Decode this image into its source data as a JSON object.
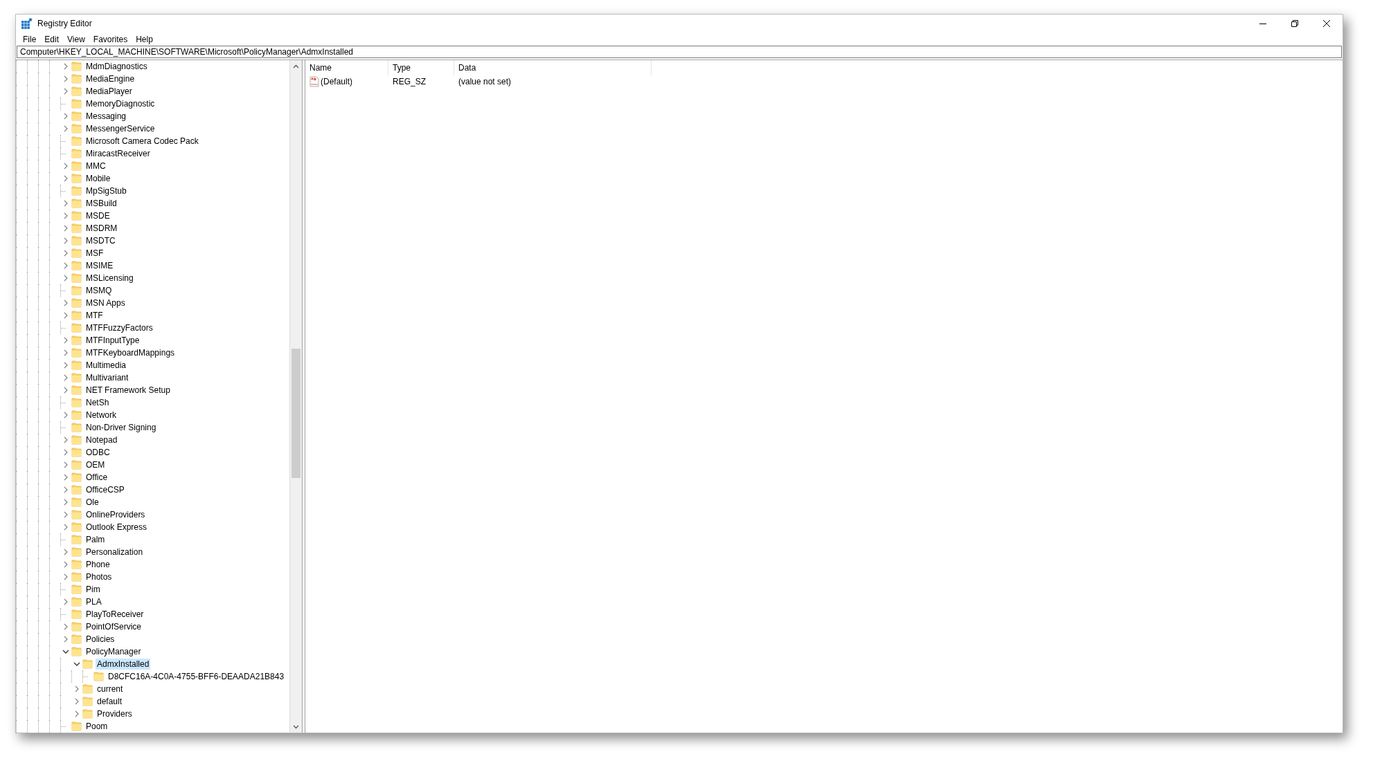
{
  "window": {
    "title": "Registry Editor"
  },
  "menu": [
    {
      "label": "File"
    },
    {
      "label": "Edit"
    },
    {
      "label": "View"
    },
    {
      "label": "Favorites"
    },
    {
      "label": "Help"
    }
  ],
  "address": {
    "value": "Computer\\HKEY_LOCAL_MACHINE\\SOFTWARE\\Microsoft\\PolicyManager\\AdmxInstalled"
  },
  "tree": {
    "items": [
      {
        "name": "MdmDiagnostics",
        "kind": "expandable",
        "expanded": false,
        "selected": false
      },
      {
        "name": "MediaEngine",
        "kind": "expandable",
        "expanded": false,
        "selected": false
      },
      {
        "name": "MediaPlayer",
        "kind": "expandable",
        "expanded": false,
        "selected": false
      },
      {
        "name": "MemoryDiagnostic",
        "kind": "leaf",
        "selected": false
      },
      {
        "name": "Messaging",
        "kind": "expandable",
        "expanded": false,
        "selected": false
      },
      {
        "name": "MessengerService",
        "kind": "expandable",
        "expanded": false,
        "selected": false
      },
      {
        "name": "Microsoft Camera Codec Pack",
        "kind": "leaf",
        "selected": false
      },
      {
        "name": "MiracastReceiver",
        "kind": "leaf",
        "selected": false
      },
      {
        "name": "MMC",
        "kind": "expandable",
        "expanded": false,
        "selected": false
      },
      {
        "name": "Mobile",
        "kind": "expandable",
        "expanded": false,
        "selected": false
      },
      {
        "name": "MpSigStub",
        "kind": "leaf",
        "selected": false
      },
      {
        "name": "MSBuild",
        "kind": "expandable",
        "expanded": false,
        "selected": false
      },
      {
        "name": "MSDE",
        "kind": "expandable",
        "expanded": false,
        "selected": false
      },
      {
        "name": "MSDRM",
        "kind": "expandable",
        "expanded": false,
        "selected": false
      },
      {
        "name": "MSDTC",
        "kind": "expandable",
        "expanded": false,
        "selected": false
      },
      {
        "name": "MSF",
        "kind": "expandable",
        "expanded": false,
        "selected": false
      },
      {
        "name": "MSIME",
        "kind": "expandable",
        "expanded": false,
        "selected": false
      },
      {
        "name": "MSLicensing",
        "kind": "expandable",
        "expanded": false,
        "selected": false
      },
      {
        "name": "MSMQ",
        "kind": "leaf",
        "selected": false
      },
      {
        "name": "MSN Apps",
        "kind": "expandable",
        "expanded": false,
        "selected": false
      },
      {
        "name": "MTF",
        "kind": "expandable",
        "expanded": false,
        "selected": false
      },
      {
        "name": "MTFFuzzyFactors",
        "kind": "leaf",
        "selected": false
      },
      {
        "name": "MTFInputType",
        "kind": "expandable",
        "expanded": false,
        "selected": false
      },
      {
        "name": "MTFKeyboardMappings",
        "kind": "expandable",
        "expanded": false,
        "selected": false
      },
      {
        "name": "Multimedia",
        "kind": "expandable",
        "expanded": false,
        "selected": false
      },
      {
        "name": "Multivariant",
        "kind": "expandable",
        "expanded": false,
        "selected": false
      },
      {
        "name": "NET Framework Setup",
        "kind": "expandable",
        "expanded": false,
        "selected": false
      },
      {
        "name": "NetSh",
        "kind": "leaf",
        "selected": false
      },
      {
        "name": "Network",
        "kind": "expandable",
        "expanded": false,
        "selected": false
      },
      {
        "name": "Non-Driver Signing",
        "kind": "leaf",
        "selected": false
      },
      {
        "name": "Notepad",
        "kind": "expandable",
        "expanded": false,
        "selected": false
      },
      {
        "name": "ODBC",
        "kind": "expandable",
        "expanded": false,
        "selected": false
      },
      {
        "name": "OEM",
        "kind": "expandable",
        "expanded": false,
        "selected": false
      },
      {
        "name": "Office",
        "kind": "expandable",
        "expanded": false,
        "selected": false
      },
      {
        "name": "OfficeCSP",
        "kind": "expandable",
        "expanded": false,
        "selected": false
      },
      {
        "name": "Ole",
        "kind": "expandable",
        "expanded": false,
        "selected": false
      },
      {
        "name": "OnlineProviders",
        "kind": "expandable",
        "expanded": false,
        "selected": false
      },
      {
        "name": "Outlook Express",
        "kind": "expandable",
        "expanded": false,
        "selected": false
      },
      {
        "name": "Palm",
        "kind": "leaf",
        "selected": false
      },
      {
        "name": "Personalization",
        "kind": "expandable",
        "expanded": false,
        "selected": false
      },
      {
        "name": "Phone",
        "kind": "expandable",
        "expanded": false,
        "selected": false
      },
      {
        "name": "Photos",
        "kind": "expandable",
        "expanded": false,
        "selected": false
      },
      {
        "name": "Pim",
        "kind": "leaf",
        "selected": false
      },
      {
        "name": "PLA",
        "kind": "expandable",
        "expanded": false,
        "selected": false
      },
      {
        "name": "PlayToReceiver",
        "kind": "leaf",
        "selected": false
      },
      {
        "name": "PointOfService",
        "kind": "expandable",
        "expanded": false,
        "selected": false
      },
      {
        "name": "Policies",
        "kind": "expandable",
        "expanded": false,
        "selected": false
      },
      {
        "name": "PolicyManager",
        "kind": "expandable",
        "expanded": true,
        "selected": false,
        "children": [
          {
            "name": "AdmxInstalled",
            "kind": "expandable",
            "expanded": true,
            "selected": true,
            "children": [
              {
                "name": "D8CFC16A-4C0A-4755-BFF6-DEAADA21B843",
                "kind": "leaf",
                "selected": false
              }
            ]
          },
          {
            "name": "current",
            "kind": "expandable",
            "expanded": false,
            "selected": false
          },
          {
            "name": "default",
            "kind": "expandable",
            "expanded": false,
            "selected": false
          },
          {
            "name": "Providers",
            "kind": "expandable",
            "expanded": false,
            "selected": false
          }
        ]
      },
      {
        "name": "Poom",
        "kind": "leaf",
        "selected": false
      }
    ]
  },
  "values": {
    "columns": [
      "Name",
      "Type",
      "Data"
    ],
    "rows": [
      {
        "name": "(Default)",
        "type": "REG_SZ",
        "data": "(value not set)",
        "kind": "string"
      }
    ]
  }
}
